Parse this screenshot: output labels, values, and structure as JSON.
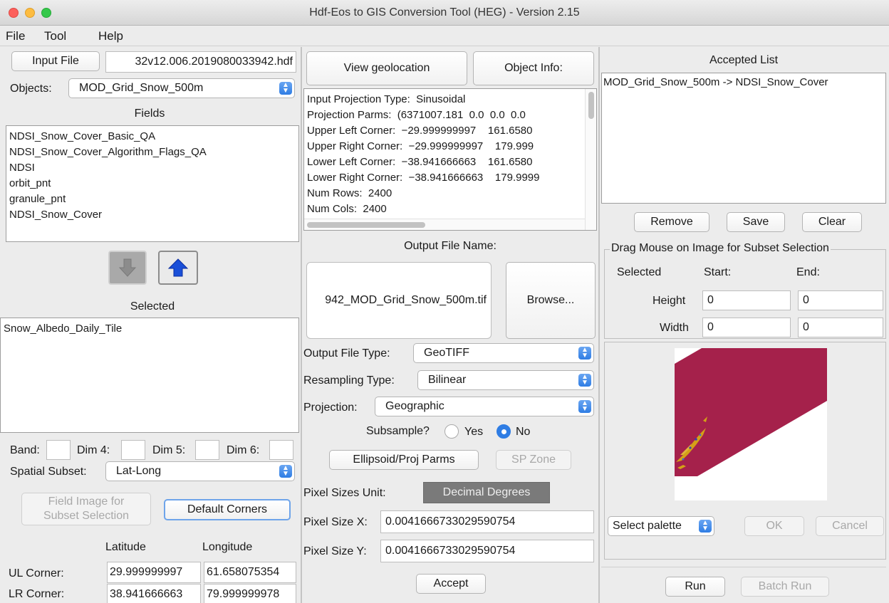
{
  "window": {
    "title": "Hdf-Eos to GIS Conversion Tool (HEG) - Version 2.15"
  },
  "menu": {
    "file": "File",
    "tool": "Tool",
    "help": "Help"
  },
  "left": {
    "input_file_button": "Input File",
    "input_file_value": "32v12.006.2019080033942.hdf",
    "objects_label": "Objects:",
    "objects_value": "MOD_Grid_Snow_500m",
    "fields_header": "Fields",
    "fields": [
      "NDSI_Snow_Cover_Basic_QA",
      "NDSI_Snow_Cover_Algorithm_Flags_QA",
      "NDSI",
      "orbit_pnt",
      "granule_pnt",
      "NDSI_Snow_Cover"
    ],
    "selected_header": "Selected",
    "selected": [
      "Snow_Albedo_Daily_Tile"
    ],
    "band_label": "Band:",
    "dim4_label": "Dim 4:",
    "dim5_label": "Dim 5:",
    "dim6_label": "Dim 6:",
    "spatial_subset_label": "Spatial Subset:",
    "spatial_subset_value": "Lat-Long",
    "field_image_button_line1": "Field Image for",
    "field_image_button_line2": "Subset Selection",
    "default_corners_button": "Default Corners",
    "latitude_header": "Latitude",
    "longitude_header": "Longitude",
    "ul_label": "UL Corner:",
    "ul_lat": "29.999999997",
    "ul_lon": "61.658075354",
    "lr_label": "LR Corner:",
    "lr_lat": "38.941666663",
    "lr_lon": "79.999999978"
  },
  "middle": {
    "view_geolocation_button": "View geolocation",
    "object_info_button": "Object Info:",
    "info_lines": [
      "Input Projection Type:  Sinusoidal",
      "Projection Parms:  (6371007.181  0.0  0.0  0.0",
      "Upper Left Corner:  −29.999999997    161.6580",
      "Upper Right Corner:  −29.999999997    179.999",
      "Lower Left Corner:  −38.941666663    161.6580",
      "Lower Right Corner:  −38.941666663    179.9999",
      "Num Rows:  2400",
      "Num Cols:  2400"
    ],
    "output_file_name_label": "Output File Name:",
    "output_file_name_value": "942_MOD_Grid_Snow_500m.tif",
    "browse_button": "Browse...",
    "output_file_type_label": "Output File Type:",
    "output_file_type_value": "GeoTIFF",
    "resampling_type_label": "Resampling Type:",
    "resampling_type_value": "Bilinear",
    "projection_label": "Projection:",
    "projection_value": "Geographic",
    "subsample_label": "Subsample?",
    "subsample_yes": "Yes",
    "subsample_no": "No",
    "ellipsoid_button": "Ellipsoid/Proj Parms",
    "sp_zone_button": "SP Zone",
    "pixel_sizes_unit_label": "Pixel Sizes Unit:",
    "pixel_sizes_unit_value": "Decimal Degrees",
    "pixel_size_x_label": "Pixel Size X:",
    "pixel_size_x_value": "0.0041666733029590754",
    "pixel_size_y_label": "Pixel Size Y:",
    "pixel_size_y_value": "0.0041666733029590754",
    "accept_button": "Accept"
  },
  "right": {
    "accepted_list_header": "Accepted List",
    "accepted_items": [
      "MOD_Grid_Snow_500m -> NDSI_Snow_Cover"
    ],
    "remove_button": "Remove",
    "save_button": "Save",
    "clear_button": "Clear",
    "subset_group_title": "Drag Mouse on Image for Subset Selection",
    "selected_col": "Selected",
    "start_col": "Start:",
    "end_col": "End:",
    "height_label": "Height",
    "height_start": "0",
    "height_end": "0",
    "width_label": "Width",
    "width_start": "0",
    "width_end": "0",
    "palette_value": "Select palette",
    "ok_button": "OK",
    "cancel_button": "Cancel",
    "run_button": "Run",
    "batch_run_button": "Batch Run"
  },
  "colors": {
    "accent": "#2f7de4",
    "snow_fill": "#a5214b",
    "snow_speckle": "#d4a017"
  }
}
